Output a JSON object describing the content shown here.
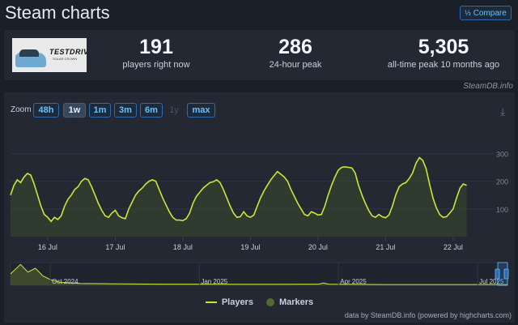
{
  "header": {
    "title": "Steam charts",
    "compare_label": "Compare",
    "compare_icon": "compare-icon"
  },
  "game": {
    "thumbnail_logo": "TESTDRIVE",
    "thumbnail_sub": "SOLAR CROWN"
  },
  "stats": [
    {
      "value": "191",
      "label": "players right now"
    },
    {
      "value": "286",
      "label": "24-hour peak"
    },
    {
      "value": "5,305",
      "label": "all-time peak 10 months ago"
    }
  ],
  "credit": "SteamDB.info",
  "zoom": {
    "label": "Zoom",
    "buttons": [
      {
        "label": "48h",
        "state": "normal"
      },
      {
        "label": "1w",
        "state": "active"
      },
      {
        "label": "1m",
        "state": "normal"
      },
      {
        "label": "3m",
        "state": "normal"
      },
      {
        "label": "6m",
        "state": "normal"
      },
      {
        "label": "1y",
        "state": "disabled"
      },
      {
        "label": "max",
        "state": "normal"
      }
    ]
  },
  "chart_data": {
    "type": "line",
    "y_ticks": [
      100,
      200,
      300
    ],
    "ylim": [
      0,
      380
    ],
    "x_labels": [
      "16 Jul",
      "17 Jul",
      "18 Jul",
      "19 Jul",
      "20 Jul",
      "21 Jul",
      "22 Jul"
    ],
    "x_range_days": [
      15.45,
      22.6
    ],
    "series": [
      {
        "name": "Players",
        "color": "#c5e83a",
        "points": [
          [
            15.45,
            150
          ],
          [
            15.5,
            185
          ],
          [
            15.55,
            205
          ],
          [
            15.6,
            195
          ],
          [
            15.65,
            215
          ],
          [
            15.7,
            228
          ],
          [
            15.75,
            222
          ],
          [
            15.8,
            190
          ],
          [
            15.85,
            150
          ],
          [
            15.9,
            110
          ],
          [
            15.95,
            80
          ],
          [
            16.0,
            70
          ],
          [
            16.05,
            55
          ],
          [
            16.1,
            70
          ],
          [
            16.15,
            62
          ],
          [
            16.2,
            75
          ],
          [
            16.25,
            110
          ],
          [
            16.3,
            135
          ],
          [
            16.35,
            150
          ],
          [
            16.4,
            170
          ],
          [
            16.45,
            180
          ],
          [
            16.5,
            200
          ],
          [
            16.55,
            210
          ],
          [
            16.6,
            205
          ],
          [
            16.65,
            180
          ],
          [
            16.7,
            150
          ],
          [
            16.75,
            120
          ],
          [
            16.8,
            95
          ],
          [
            16.85,
            75
          ],
          [
            16.9,
            70
          ],
          [
            16.95,
            85
          ],
          [
            17.0,
            95
          ],
          [
            17.05,
            75
          ],
          [
            17.1,
            68
          ],
          [
            17.15,
            65
          ],
          [
            17.2,
            100
          ],
          [
            17.25,
            125
          ],
          [
            17.3,
            150
          ],
          [
            17.35,
            165
          ],
          [
            17.4,
            175
          ],
          [
            17.45,
            190
          ],
          [
            17.5,
            200
          ],
          [
            17.55,
            205
          ],
          [
            17.6,
            200
          ],
          [
            17.65,
            170
          ],
          [
            17.7,
            140
          ],
          [
            17.75,
            115
          ],
          [
            17.8,
            90
          ],
          [
            17.85,
            70
          ],
          [
            17.9,
            60
          ],
          [
            17.95,
            60
          ],
          [
            18.0,
            58
          ],
          [
            18.05,
            65
          ],
          [
            18.1,
            85
          ],
          [
            18.15,
            120
          ],
          [
            18.2,
            145
          ],
          [
            18.25,
            160
          ],
          [
            18.3,
            175
          ],
          [
            18.35,
            185
          ],
          [
            18.4,
            195
          ],
          [
            18.45,
            198
          ],
          [
            18.5,
            205
          ],
          [
            18.55,
            195
          ],
          [
            18.6,
            170
          ],
          [
            18.65,
            140
          ],
          [
            18.7,
            110
          ],
          [
            18.75,
            85
          ],
          [
            18.8,
            70
          ],
          [
            18.85,
            72
          ],
          [
            18.9,
            90
          ],
          [
            18.95,
            75
          ],
          [
            19.0,
            70
          ],
          [
            19.05,
            78
          ],
          [
            19.1,
            110
          ],
          [
            19.15,
            140
          ],
          [
            19.2,
            165
          ],
          [
            19.25,
            185
          ],
          [
            19.3,
            205
          ],
          [
            19.35,
            220
          ],
          [
            19.4,
            235
          ],
          [
            19.45,
            225
          ],
          [
            19.5,
            215
          ],
          [
            19.55,
            200
          ],
          [
            19.6,
            170
          ],
          [
            19.65,
            145
          ],
          [
            19.7,
            120
          ],
          [
            19.75,
            100
          ],
          [
            19.8,
            80
          ],
          [
            19.85,
            75
          ],
          [
            19.9,
            90
          ],
          [
            19.95,
            85
          ],
          [
            20.0,
            78
          ],
          [
            20.05,
            80
          ],
          [
            20.1,
            110
          ],
          [
            20.15,
            150
          ],
          [
            20.2,
            185
          ],
          [
            20.25,
            215
          ],
          [
            20.3,
            240
          ],
          [
            20.35,
            250
          ],
          [
            20.4,
            252
          ],
          [
            20.45,
            250
          ],
          [
            20.5,
            248
          ],
          [
            20.55,
            230
          ],
          [
            20.6,
            185
          ],
          [
            20.65,
            150
          ],
          [
            20.7,
            120
          ],
          [
            20.75,
            95
          ],
          [
            20.8,
            75
          ],
          [
            20.85,
            70
          ],
          [
            20.9,
            80
          ],
          [
            20.95,
            72
          ],
          [
            21.0,
            68
          ],
          [
            21.05,
            78
          ],
          [
            21.1,
            110
          ],
          [
            21.15,
            150
          ],
          [
            21.2,
            180
          ],
          [
            21.25,
            190
          ],
          [
            21.3,
            195
          ],
          [
            21.35,
            210
          ],
          [
            21.4,
            230
          ],
          [
            21.45,
            265
          ],
          [
            21.5,
            285
          ],
          [
            21.55,
            275
          ],
          [
            21.6,
            245
          ],
          [
            21.65,
            190
          ],
          [
            21.7,
            140
          ],
          [
            21.75,
            105
          ],
          [
            21.8,
            80
          ],
          [
            21.85,
            70
          ],
          [
            21.9,
            72
          ],
          [
            21.95,
            85
          ],
          [
            22.0,
            100
          ],
          [
            22.05,
            140
          ],
          [
            22.1,
            175
          ],
          [
            22.15,
            190
          ],
          [
            22.2,
            185
          ]
        ]
      },
      {
        "name": "Markers",
        "color": "#546a33"
      }
    ],
    "navigator": {
      "labels": [
        "Oct 2024",
        "Jan 2025",
        "Apr 2025",
        "Jul 2025"
      ],
      "points": [
        [
          0.0,
          30
        ],
        [
          0.02,
          55
        ],
        [
          0.035,
          35
        ],
        [
          0.05,
          45
        ],
        [
          0.065,
          25
        ],
        [
          0.08,
          15
        ],
        [
          0.1,
          8
        ],
        [
          0.14,
          5
        ],
        [
          0.2,
          4
        ],
        [
          0.3,
          3
        ],
        [
          0.37,
          3
        ],
        [
          0.45,
          2.5
        ],
        [
          0.55,
          2.5
        ],
        [
          0.62,
          3
        ],
        [
          0.63,
          6
        ],
        [
          0.64,
          3
        ],
        [
          0.75,
          2
        ],
        [
          0.85,
          2
        ],
        [
          0.95,
          2
        ],
        [
          1.0,
          2
        ]
      ]
    }
  },
  "legend": {
    "players": "Players",
    "markers": "Markers"
  },
  "data_credit": "data by SteamDB.info (powered by highcharts.com)"
}
